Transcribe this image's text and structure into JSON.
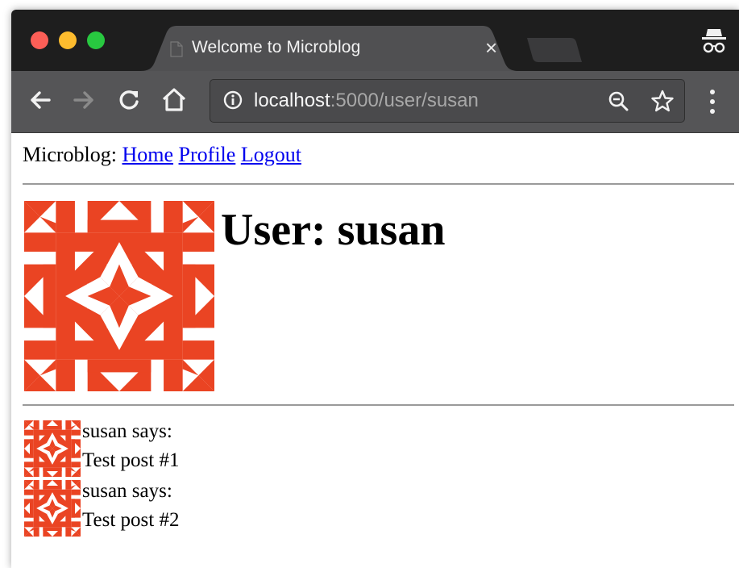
{
  "browser": {
    "tab_title": "Welcome to Microblog",
    "url_host": "localhost",
    "url_rest": ":5000/user/susan"
  },
  "icons": {
    "tab_close": "close-icon",
    "back": "back-arrow-icon",
    "forward": "forward-arrow-icon",
    "reload": "reload-icon",
    "home": "home-icon",
    "info": "info-icon",
    "zoom": "zoom-out-icon",
    "star": "bookmark-star-icon",
    "menu": "menu-dots-icon",
    "incognito": "incognito-icon"
  },
  "nav": {
    "brand": "Microblog:",
    "links": [
      "Home",
      "Profile",
      "Logout"
    ]
  },
  "user": {
    "heading": "User: susan"
  },
  "posts": [
    {
      "author_line": "susan says:",
      "body": "Test post #1"
    },
    {
      "author_line": "susan says:",
      "body": "Test post #2"
    }
  ],
  "colors": {
    "avatar": "#ea4423",
    "link": "#0000ee",
    "titlebar": "#1e1e1e",
    "toolbar": "#555557"
  }
}
